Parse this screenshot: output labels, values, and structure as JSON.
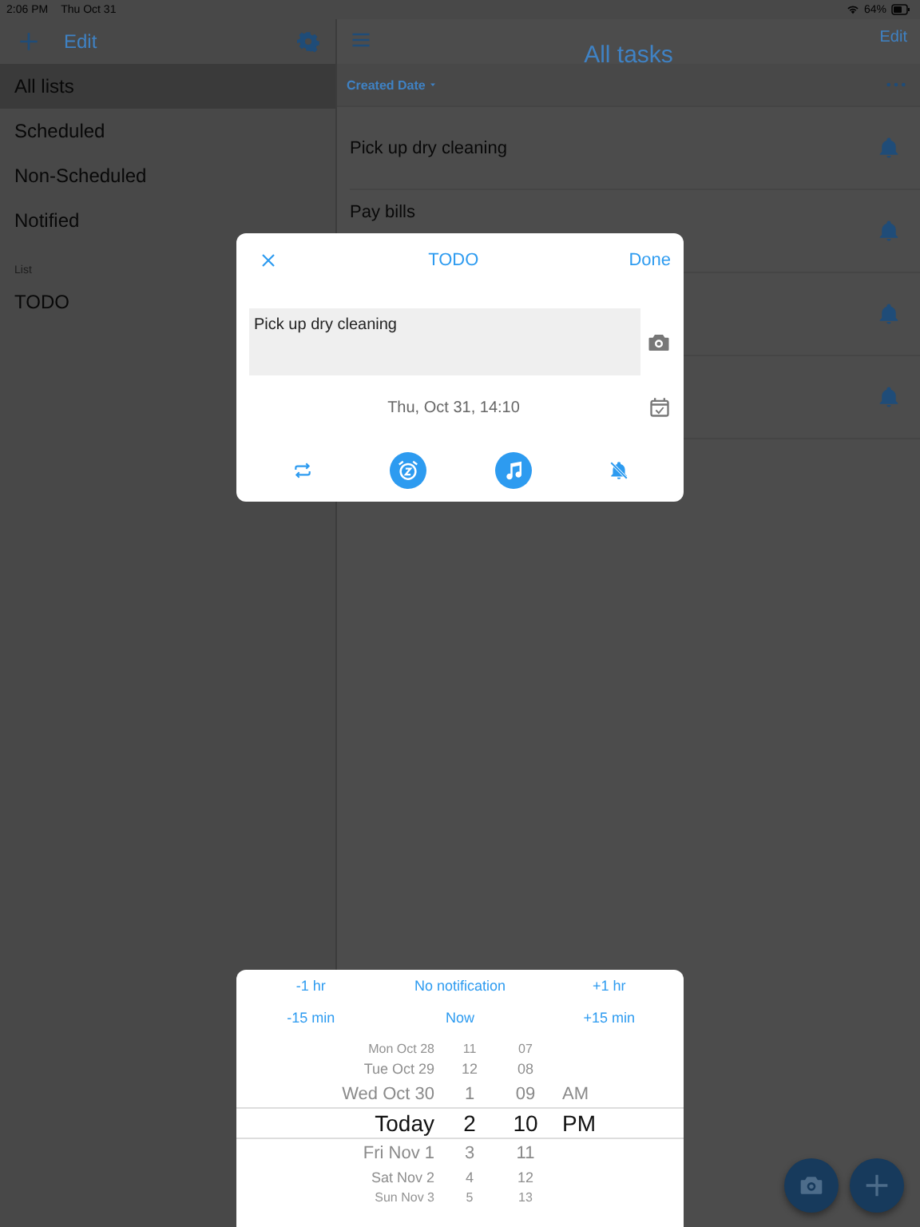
{
  "status_bar": {
    "time": "2:06 PM",
    "date": "Thu Oct 31",
    "battery": "64%"
  },
  "sidebar": {
    "edit": "Edit",
    "items": [
      {
        "label": "All lists",
        "selected": true
      },
      {
        "label": "Scheduled",
        "selected": false
      },
      {
        "label": "Non-Scheduled",
        "selected": false
      },
      {
        "label": "Notified",
        "selected": false
      }
    ],
    "section": "List",
    "lists": [
      {
        "label": "TODO",
        "selected": false
      }
    ]
  },
  "main": {
    "title": "All tasks",
    "edit": "Edit",
    "sort": "Created Date",
    "tasks": [
      {
        "title": "Pick up dry cleaning",
        "notify": true
      },
      {
        "title": "Pay bills",
        "notify": true
      },
      {
        "notify": true
      },
      {
        "notify": true
      }
    ]
  },
  "dialog": {
    "list": "TODO",
    "done": "Done",
    "text": "Pick up dry cleaning",
    "due": "Thu, Oct 31, 14:10",
    "actions": [
      {
        "kind": "repeat",
        "on": false
      },
      {
        "kind": "alarm",
        "on": true
      },
      {
        "kind": "sound",
        "on": true
      },
      {
        "kind": "mute",
        "on": false
      }
    ]
  },
  "picker": {
    "buttons": [
      "-1 hr",
      "No notification",
      "+1 hr",
      "-15 min",
      "Now",
      "+15 min"
    ],
    "rows": [
      {
        "day": "Mon Oct 28",
        "hour": "11",
        "minute": "07",
        "selected": false
      },
      {
        "day": "Tue Oct 29",
        "hour": "12",
        "minute": "08",
        "selected": false
      },
      {
        "day": "Wed Oct 30",
        "hour": "1",
        "minute": "09",
        "period": "AM",
        "selected": false
      },
      {
        "day": "Today",
        "hour": "2",
        "minute": "10",
        "period": "PM",
        "selected": true
      },
      {
        "day": "Fri Nov 1",
        "hour": "3",
        "minute": "11",
        "selected": false
      },
      {
        "day": "Sat Nov 2",
        "hour": "4",
        "minute": "12",
        "selected": false
      },
      {
        "day": "Sun Nov 3",
        "hour": "5",
        "minute": "13",
        "selected": false
      }
    ]
  }
}
